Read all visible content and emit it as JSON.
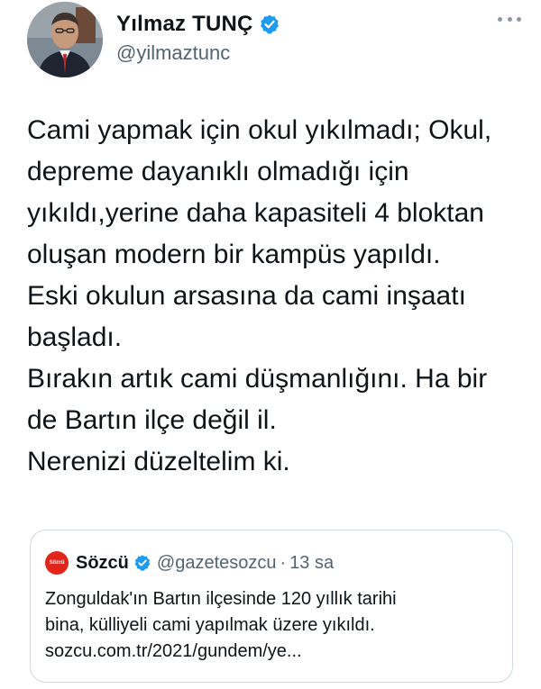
{
  "tweet": {
    "author": {
      "display_name": "Yılmaz TUNÇ",
      "handle": "@yilmaztunc",
      "verified": true,
      "avatar_icon": "profile-photo"
    },
    "more_icon": "more-horizontal-icon",
    "text_lines": [
      "Cami yapmak için okul yıkılmadı; Okul,",
      "depreme dayanıklı olmadığı için",
      "yıkıldı,yerine daha kapasiteli 4 bloktan",
      "oluşan modern bir kampüs yapıldı.",
      "Eski okulun arsasına da cami inşaatı",
      "başladı.",
      "Bırakın artık cami düşmanlığını. Ha bir",
      "de Bartın ilçe değil il.",
      "Nerenizi düzeltelim ki."
    ],
    "quoted": {
      "logo_text": "Sözcü",
      "display_name": "Sözcü",
      "handle": "@gazetesozcu",
      "separator": "·",
      "time": "13 sa",
      "verified": true,
      "text_lines": [
        "Zonguldak'ın Bartın ilçesinde 120 yıllık tarihi",
        "bina, külliyeli cami yapılmak üzere yıkıldı.",
        "sozcu.com.tr/2021/gundem/ye..."
      ]
    }
  },
  "colors": {
    "text": "#0f1419",
    "secondary": "#536471",
    "verified": "#1d9bf0",
    "border": "#cfd9de",
    "sozcu_red": "#e1251b"
  }
}
